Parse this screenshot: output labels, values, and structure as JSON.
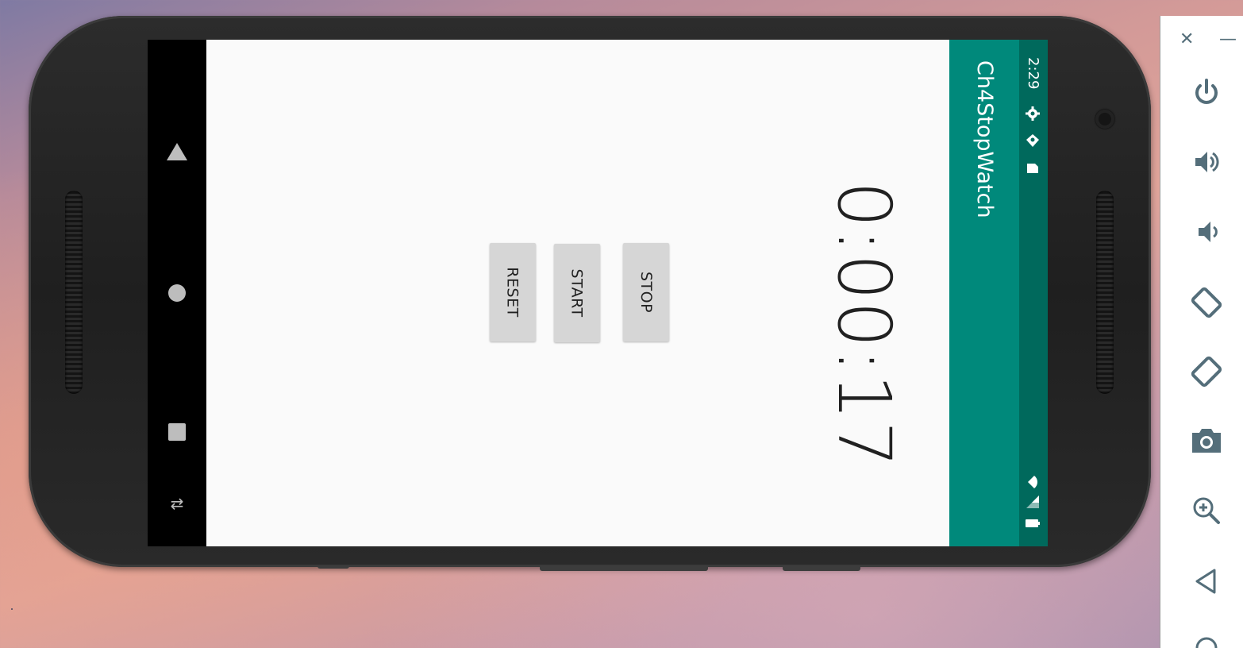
{
  "app": {
    "title": "Ch4StopWatch",
    "timer_value": "0:00:17",
    "buttons": {
      "stop": "STOP",
      "start": "START",
      "reset": "RESET"
    }
  },
  "status_bar": {
    "time": "2:29",
    "left_icons": [
      "settings-icon",
      "shield-icon",
      "sd-card-icon"
    ],
    "right_icons": [
      "wifi-icon",
      "signal-icon",
      "battery-icon"
    ]
  },
  "nav_bar": {
    "buttons": [
      "back-icon",
      "home-icon",
      "recents-icon",
      "rotate-icon"
    ]
  },
  "emulator_controls": {
    "window": [
      "close-icon",
      "minimize-icon"
    ],
    "window_close_glyph": "✕",
    "window_minimize_glyph": "—",
    "items": [
      "power-icon",
      "volume-up-icon",
      "volume-down-icon",
      "rotate-left-icon",
      "rotate-right-icon",
      "camera-icon",
      "zoom-icon",
      "back-icon",
      "home-icon"
    ]
  },
  "colors": {
    "toolbar": "#00897b",
    "status_bar": "#00695c",
    "background": "#fafafa",
    "button": "#d6d6d6",
    "emulator_icon": "#546e7a"
  }
}
